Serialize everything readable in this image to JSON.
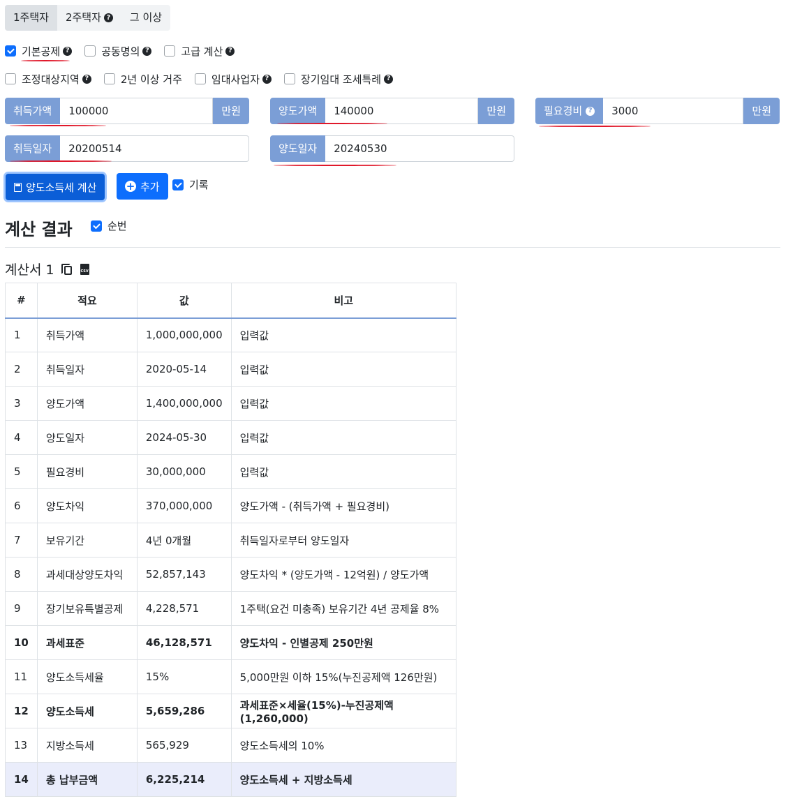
{
  "tabs": [
    {
      "label": "1주택자",
      "help": false
    },
    {
      "label": "2주택자",
      "help": true
    },
    {
      "label": "그 이상",
      "help": false
    }
  ],
  "options_row1": [
    {
      "label": "기본공제",
      "checked": true,
      "help": true
    },
    {
      "label": "공동명의",
      "checked": false,
      "help": true
    },
    {
      "label": "고급 계산",
      "checked": false,
      "help": true
    }
  ],
  "options_row2": [
    {
      "label": "조정대상지역",
      "checked": false,
      "help": true
    },
    {
      "label": "2년 이상 거주",
      "checked": false,
      "help": false
    },
    {
      "label": "임대사업자",
      "checked": false,
      "help": true
    },
    {
      "label": "장기임대 조세특례",
      "checked": false,
      "help": true
    }
  ],
  "help_icon": "question-circle-icon",
  "inputs": {
    "acq_price": {
      "label": "취득가액",
      "value": "100000",
      "unit": "만원"
    },
    "sale_price": {
      "label": "양도가액",
      "value": "140000",
      "unit": "만원"
    },
    "expense": {
      "label": "필요경비",
      "value": "3000",
      "unit": "만원"
    },
    "acq_date": {
      "label": "취득일자",
      "value": "20200514"
    },
    "sale_date": {
      "label": "양도일자",
      "value": "20240530"
    }
  },
  "buttons": {
    "calc": "양도소득세 계산",
    "add": "추가"
  },
  "record": {
    "label": "기록",
    "checked": true
  },
  "result": {
    "title": "계산 결과",
    "seq_label": "순번",
    "seq_checked": true,
    "sheet_title": "계산서 1",
    "csv_icon_text": "CSV"
  },
  "table": {
    "headers": [
      "#",
      "적요",
      "값",
      "비고"
    ],
    "rows": [
      {
        "n": "1",
        "item": "취득가액",
        "value": "1,000,000,000",
        "note": "입력값"
      },
      {
        "n": "2",
        "item": "취득일자",
        "value": "2020-05-14",
        "note": "입력값"
      },
      {
        "n": "3",
        "item": "양도가액",
        "value": "1,400,000,000",
        "note": "입력값"
      },
      {
        "n": "4",
        "item": "양도일자",
        "value": "2024-05-30",
        "note": "입력값"
      },
      {
        "n": "5",
        "item": "필요경비",
        "value": "30,000,000",
        "note": "입력값"
      },
      {
        "n": "6",
        "item": "양도차익",
        "value": "370,000,000",
        "note": "양도가액 - (취득가액 + 필요경비)"
      },
      {
        "n": "7",
        "item": "보유기간",
        "value": "4년 0개월",
        "note": "취득일자로부터 양도일자"
      },
      {
        "n": "8",
        "item": "과세대상양도차익",
        "value": "52,857,143",
        "note": "양도차익 * (양도가액 - 12억원) / 양도가액"
      },
      {
        "n": "9",
        "item": "장기보유특별공제",
        "value": "4,228,571",
        "note": "1주택(요건 미충족) 보유기간 4년 공제율 8%"
      },
      {
        "n": "10",
        "item": "과세표준",
        "value": "46,128,571",
        "note": "양도차익 - 인별공제 250만원"
      },
      {
        "n": "11",
        "item": "양도소득세율",
        "value": "15%",
        "note": "5,000만원 이하 15%(누진공제액 126만원)"
      },
      {
        "n": "12",
        "item": "양도소득세",
        "value": "5,659,286",
        "note": "과세표준×세율(15%)-누진공제액(1,260,000)"
      },
      {
        "n": "13",
        "item": "지방소득세",
        "value": "565,929",
        "note": "양도소득세의 10%"
      },
      {
        "n": "14",
        "item": "총 납부금액",
        "value": "6,225,214",
        "note": "양도소득세 + 지방소득세"
      }
    ]
  }
}
